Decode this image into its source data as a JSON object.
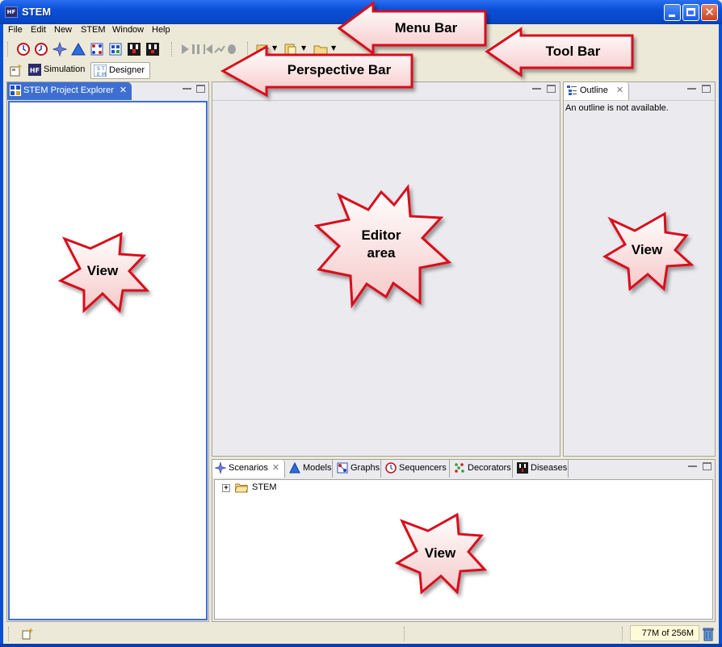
{
  "window": {
    "title": "STEM",
    "app_icon_text": "HF"
  },
  "menu": [
    {
      "id": "file",
      "label": "File"
    },
    {
      "id": "edit",
      "label": "Edit"
    },
    {
      "id": "new",
      "label": "New"
    },
    {
      "id": "stem",
      "label": "STEM"
    },
    {
      "id": "window",
      "label": "Window"
    },
    {
      "id": "help",
      "label": "Help"
    }
  ],
  "perspectives": [
    {
      "label": "Simulation",
      "icon": "hf-icon",
      "active": false
    },
    {
      "label": "Designer",
      "icon": "stem-designer-icon",
      "active": true
    }
  ],
  "project_explorer": {
    "title": "STEM Project Explorer"
  },
  "outline": {
    "title": "Outline",
    "message": "An outline is not available."
  },
  "bottom_tabs": [
    {
      "label": "Scenarios",
      "icon": "scenario-star-icon"
    },
    {
      "label": "Models",
      "icon": "model-triangle-icon"
    },
    {
      "label": "Graphs",
      "icon": "graph-icon"
    },
    {
      "label": "Sequencers",
      "icon": "clock-icon"
    },
    {
      "label": "Decorators",
      "icon": "decorator-dots-icon"
    },
    {
      "label": "Diseases",
      "icon": "disease-icon"
    }
  ],
  "scenarios_tree": {
    "root_label": "STEM",
    "expander": "+"
  },
  "status": {
    "heap": "77M of 256M"
  },
  "annotations": {
    "menu_bar": "Menu Bar",
    "tool_bar": "Tool Bar",
    "perspective_bar": "Perspective Bar",
    "editor_area_line1": "Editor",
    "editor_area_line2": "area",
    "view": "View"
  },
  "colors": {
    "title_bar": "#0a4fd8",
    "window_bg": "#ece9d8",
    "callout_red": "#d8101a",
    "callout_fill": "#fde8e8",
    "heap_bg": "#fffbd8"
  }
}
